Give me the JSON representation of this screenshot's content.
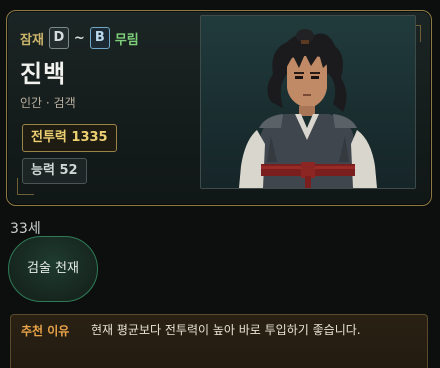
{
  "character": {
    "talent_label": "잠재",
    "talent_from": "D",
    "talent_tilde": "~",
    "talent_to": "B",
    "faction": "무림",
    "name": "진백",
    "race_class": "인간 · 검객",
    "combat_power": "전투력 1335",
    "ability": "능력 52",
    "age": "33세",
    "trait": "검술 천재"
  },
  "recommendation": {
    "label": "추천 이유",
    "text": "현재 평균보다 전투력이 높아 바로 투입하기 좋습니다."
  },
  "colors": {
    "accent_gold": "#c9b46a",
    "faction_green": "#7fd07a",
    "power_gold": "#ecd072",
    "recommend_orange": "#e8a34a",
    "card_border": "#8f7a44"
  },
  "icons": {
    "portrait": "pixel-swordsman-portrait"
  }
}
